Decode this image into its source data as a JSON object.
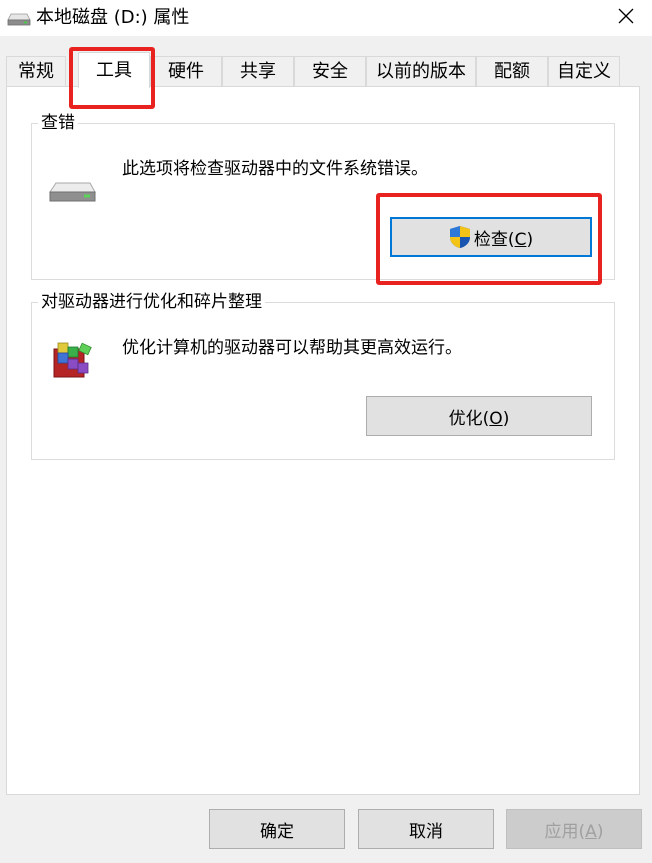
{
  "window": {
    "title": "本地磁盘 (D:) 属性"
  },
  "tabs": [
    {
      "label": "常规"
    },
    {
      "label": "工具"
    },
    {
      "label": "硬件"
    },
    {
      "label": "共享"
    },
    {
      "label": "安全"
    },
    {
      "label": "以前的版本"
    },
    {
      "label": "配额"
    },
    {
      "label": "自定义"
    }
  ],
  "active_tab": "工具",
  "error_check": {
    "title": "查错",
    "description": "此选项将检查驱动器中的文件系统错误。",
    "button_prefix": "检查(",
    "button_mnemonic": "C",
    "button_suffix": ")"
  },
  "optimize": {
    "title": "对驱动器进行优化和碎片整理",
    "description": "优化计算机的驱动器可以帮助其更高效运行。",
    "button_prefix": "优化(",
    "button_mnemonic": "O",
    "button_suffix": ")"
  },
  "footer": {
    "ok_label": "确定",
    "cancel_label": "取消",
    "apply_prefix": "应用(",
    "apply_mnemonic": "A",
    "apply_suffix": ")"
  },
  "colors": {
    "highlight": "#e8231f",
    "focus": "#0078d7"
  }
}
